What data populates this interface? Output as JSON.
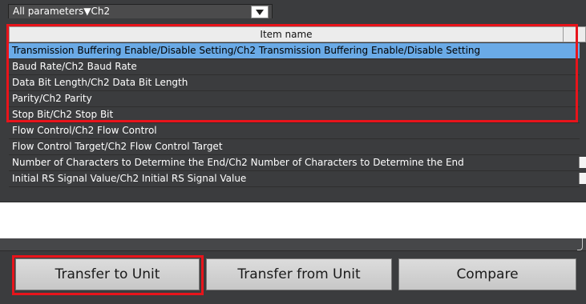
{
  "filter": {
    "value": "All parameters▼Ch2",
    "arrow_icon": "dropdown-arrow"
  },
  "grid": {
    "column_header": "Item name",
    "rows": [
      {
        "name": "Transmission Buffering Enable/Disable Setting/Ch2 Transmission Buffering Enable/Disable Setting",
        "selected": true
      },
      {
        "name": "Baud Rate/Ch2 Baud Rate",
        "selected": false
      },
      {
        "name": "Data Bit Length/Ch2 Data Bit Length",
        "selected": false
      },
      {
        "name": "Parity/Ch2 Parity",
        "selected": false
      },
      {
        "name": "Stop Bit/Ch2 Stop Bit",
        "selected": false
      },
      {
        "name": "Flow Control/Ch2 Flow Control",
        "selected": false
      },
      {
        "name": "Flow Control Target/Ch2 Flow Control Target",
        "selected": false
      },
      {
        "name": "Number of Characters to Determine the End/Ch2 Number of Characters to Determine the End",
        "selected": false
      },
      {
        "name": "Initial RS Signal Value/Ch2 Initial RS Signal Value",
        "selected": false
      }
    ]
  },
  "buttons": {
    "transfer_to_unit": "Transfer to Unit",
    "transfer_from_unit": "Transfer from Unit",
    "compare": "Compare"
  },
  "colors": {
    "panel_bg": "#3b3c3e",
    "selection": "#6aaae6",
    "highlight_box": "#e8141b"
  }
}
